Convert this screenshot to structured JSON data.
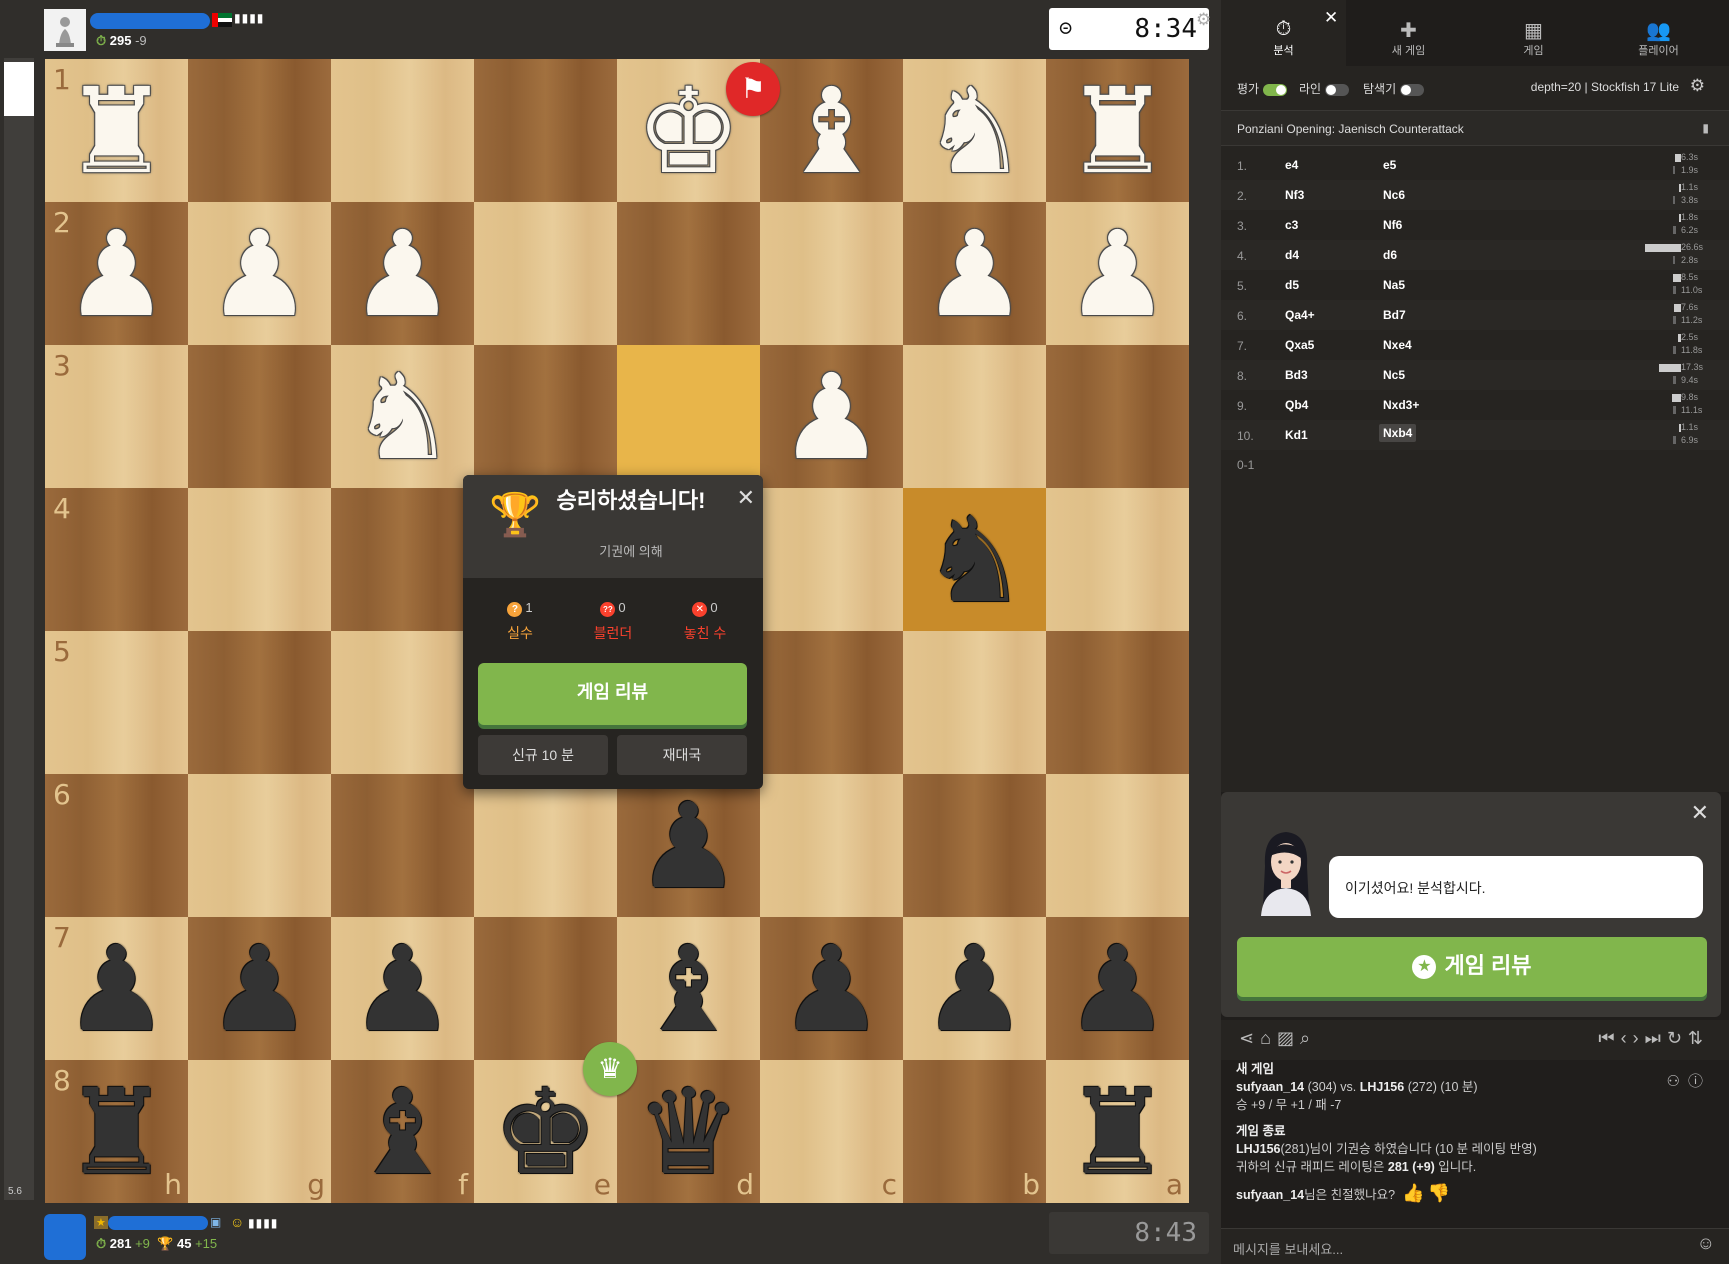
{
  "top_player": {
    "rating": "295",
    "rating_change": "-9",
    "signal": "▮▮▮▮",
    "clock": "8:34"
  },
  "bottom_player": {
    "rating": "281",
    "rating_change": "+9",
    "puzzle_rating": "45",
    "puzzle_change": "+15",
    "signal": "▮▮▮▮",
    "clock": "8:43"
  },
  "eval_value": "5.6",
  "board": {
    "ranks": [
      "1",
      "2",
      "3",
      "4",
      "5",
      "6",
      "7",
      "8"
    ],
    "files": [
      "h",
      "g",
      "f",
      "e",
      "d",
      "c",
      "b",
      "a"
    ],
    "pieces": [
      {
        "glyph": "♜",
        "color": "w",
        "col": 0,
        "row": 0
      },
      {
        "glyph": "♚",
        "color": "w",
        "col": 4,
        "row": 0
      },
      {
        "glyph": "♝",
        "color": "w",
        "col": 5,
        "row": 0
      },
      {
        "glyph": "♞",
        "color": "w",
        "col": 6,
        "row": 0
      },
      {
        "glyph": "♜",
        "color": "w",
        "col": 7,
        "row": 0
      },
      {
        "glyph": "♟",
        "color": "w",
        "col": 0,
        "row": 1
      },
      {
        "glyph": "♟",
        "color": "w",
        "col": 1,
        "row": 1
      },
      {
        "glyph": "♟",
        "color": "w",
        "col": 2,
        "row": 1
      },
      {
        "glyph": "♟",
        "color": "w",
        "col": 6,
        "row": 1
      },
      {
        "glyph": "♟",
        "color": "w",
        "col": 7,
        "row": 1
      },
      {
        "glyph": "♞",
        "color": "w",
        "col": 2,
        "row": 2
      },
      {
        "glyph": "♟",
        "color": "w",
        "col": 5,
        "row": 2
      },
      {
        "glyph": "♞",
        "color": "b",
        "col": 6,
        "row": 3
      },
      {
        "glyph": "♟",
        "color": "b",
        "col": 4,
        "row": 5
      },
      {
        "glyph": "♟",
        "color": "b",
        "col": 0,
        "row": 6
      },
      {
        "glyph": "♟",
        "color": "b",
        "col": 1,
        "row": 6
      },
      {
        "glyph": "♟",
        "color": "b",
        "col": 2,
        "row": 6
      },
      {
        "glyph": "♝",
        "color": "b",
        "col": 4,
        "row": 6
      },
      {
        "glyph": "♟",
        "color": "b",
        "col": 5,
        "row": 6
      },
      {
        "glyph": "♟",
        "color": "b",
        "col": 6,
        "row": 6
      },
      {
        "glyph": "♟",
        "color": "b",
        "col": 7,
        "row": 6
      },
      {
        "glyph": "♜",
        "color": "b",
        "col": 0,
        "row": 7
      },
      {
        "glyph": "♝",
        "color": "b",
        "col": 2,
        "row": 7
      },
      {
        "glyph": "♚",
        "color": "b",
        "col": 3,
        "row": 7
      },
      {
        "glyph": "♛",
        "color": "b",
        "col": 4,
        "row": 7
      },
      {
        "glyph": "♜",
        "color": "b",
        "col": 7,
        "row": 7
      }
    ],
    "highlight_from": {
      "col": 4,
      "row": 2
    },
    "highlight_to": {
      "col": 6,
      "row": 3
    },
    "light_color": "#e3c48e",
    "dark_color": "#9a6a3c"
  },
  "modal": {
    "title": "승리하셨습니다!",
    "subtitle": "기권에 의해",
    "stats": [
      {
        "icon": "?",
        "count": "1",
        "label": "실수",
        "color": "#f7a33a"
      },
      {
        "icon": "??",
        "count": "0",
        "label": "블런더",
        "color": "#fa412d"
      },
      {
        "icon": "✕",
        "count": "0",
        "label": "놓친 수",
        "color": "#fa412d"
      }
    ],
    "review_label": "게임 리뷰",
    "new_game_label": "신규 10 분",
    "rematch_label": "재대국"
  },
  "tabs": [
    {
      "label": "분석",
      "icon": "⏱"
    },
    {
      "label": "새 게임",
      "icon": "✚"
    },
    {
      "label": "게임",
      "icon": "▦"
    },
    {
      "label": "플레이어",
      "icon": "👥"
    }
  ],
  "toggles": {
    "eval_label": "평가",
    "lines_label": "라인",
    "explorer_label": "탐색기",
    "engine": "depth=20 | Stockfish 17 Lite"
  },
  "opening": "Ponziani Opening: Jaenisch Counterattack",
  "moves": [
    {
      "no": "1.",
      "w": "e4",
      "b": "e5",
      "tw": "6.3s",
      "tb": "1.9s",
      "fw": 0.15,
      "fb": 0.05
    },
    {
      "no": "2.",
      "w": "Nf3",
      "b": "Nc6",
      "tw": "1.1s",
      "tb": "3.8s",
      "fw": 0.04,
      "fb": 0.1
    },
    {
      "no": "3.",
      "w": "c3",
      "b": "Nf6",
      "tw": "1.8s",
      "tb": "6.2s",
      "fw": 0.05,
      "fb": 0.15
    },
    {
      "no": "4.",
      "w": "d4",
      "b": "d6",
      "tw": "26.6s",
      "tb": "2.8s",
      "fw": 0.9,
      "fb": 0.07
    },
    {
      "no": "5.",
      "w": "d5",
      "b": "Na5",
      "tw": "8.5s",
      "tb": "11.0s",
      "fw": 0.2,
      "fb": 0.27
    },
    {
      "no": "6.",
      "w": "Qa4+",
      "b": "Bd7",
      "tw": "7.6s",
      "tb": "11.2s",
      "fw": 0.18,
      "fb": 0.27
    },
    {
      "no": "7.",
      "w": "Qxa5",
      "b": "Nxe4",
      "tw": "2.5s",
      "tb": "11.8s",
      "fw": 0.07,
      "fb": 0.28
    },
    {
      "no": "8.",
      "w": "Bd3",
      "b": "Nc5",
      "tw": "17.3s",
      "tb": "9.4s",
      "fw": 0.55,
      "fb": 0.22
    },
    {
      "no": "9.",
      "w": "Qb4",
      "b": "Nxd3+",
      "tw": "9.8s",
      "tb": "11.1s",
      "fw": 0.23,
      "fb": 0.27
    },
    {
      "no": "10.",
      "w": "Kd1",
      "b": "Nxb4",
      "tw": "1.1s",
      "tb": "6.9s",
      "fw": 0.04,
      "fb": 0.16
    }
  ],
  "result": "0-1",
  "coach": {
    "message": "이기셨어요! 분석합시다.",
    "review_label": "게임 리뷰"
  },
  "log": {
    "new_game_header": "새 게임",
    "player1": "sufyaan_14",
    "player1_rating": "(304) vs.",
    "player2": "LHJ156",
    "player2_rating": "(272) (10 분)",
    "record": "승 +9 / 무 +1 / 패 -7",
    "end_header": "게임 종료",
    "end_player": "LHJ156",
    "end_text": "(281)님이 기권승 하였습니다 (10 분 레이팅 반영)",
    "rapid_text_1": "귀하의 신규 래피드 레이팅은",
    "rapid_value": "281 (+9)",
    "rapid_text_2": "입니다.",
    "friendly_name": "sufyaan_14",
    "friendly_text": "님은 친절했나요?"
  },
  "message_placeholder": "메시지를 보내세요..."
}
